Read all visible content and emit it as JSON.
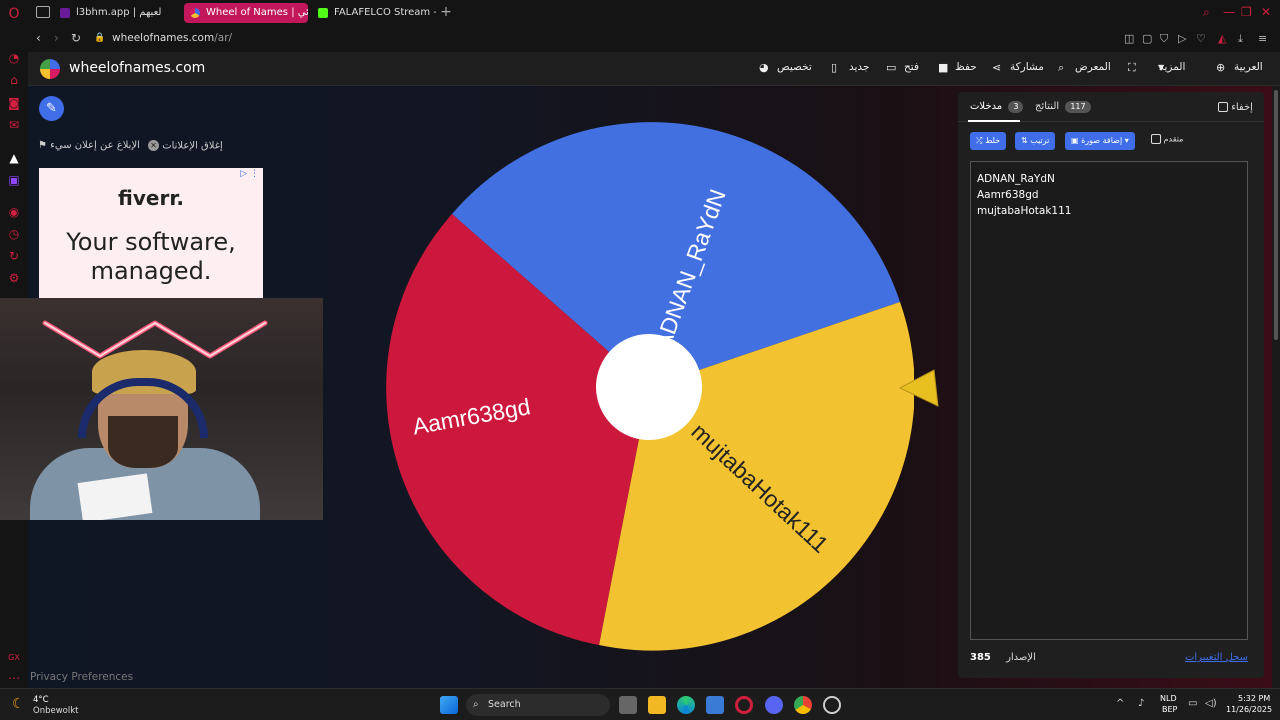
{
  "browser": {
    "tabs": [
      {
        "label": "l3bhm.app | لعبهم"
      },
      {
        "label": "Wheel of Names | عشوائي"
      },
      {
        "label": "FALAFELCO Stream - Wat"
      }
    ],
    "url_host": "wheelofnames.com",
    "url_path": "/ar/"
  },
  "site": {
    "logo_text": "wheelofnames.com",
    "menu": {
      "customize": "تخصيص",
      "new": "جديد",
      "open": "فتح",
      "save": "حفظ",
      "share": "مشاركة",
      "gallery": "المعرض",
      "more": "المزيد",
      "language": "العربية"
    }
  },
  "ads": {
    "close_ads": "إغلاق الإعلانات",
    "report_ad": "الإبلاغ عن إعلان سيء",
    "brand": "fiverr.",
    "line1": "Your software,",
    "line2": "managed."
  },
  "wheel": {
    "segments": [
      {
        "label": "ADNAN_RaYdN",
        "color": "#4370E0"
      },
      {
        "label": "mujtabaHotak111",
        "color": "#F2C230"
      },
      {
        "label": "Aamr638gd",
        "color": "#CC183C"
      }
    ]
  },
  "panel": {
    "tab_entries": "مدخلات",
    "entries_count": "3",
    "tab_results": "النتائج",
    "results_count": "117",
    "hide_label": "إخفاء",
    "shuffle": "خلط",
    "sort": "ترتيب",
    "add_image": "إضافة صورة",
    "advanced": "متقدم",
    "entries": [
      "ADNAN_RaYdN",
      "Aamr638gd",
      "mujtabaHotak111"
    ],
    "version_label": "الإصدار",
    "version_number": "385",
    "changelog": "سجل التغييرات"
  },
  "privacy": "Privacy Preferences",
  "taskbar": {
    "weather_temp": "4°C",
    "weather_desc": "Onbewolkt",
    "search_placeholder": "Search",
    "lang_line1": "NLD",
    "lang_line2": "BEP",
    "time": "5:32 PM",
    "date": "11/26/2025"
  },
  "colors": {
    "accent_blue": "#3f6ee8",
    "opera_red": "#d11f3f",
    "active_tab": "#c2185b"
  }
}
